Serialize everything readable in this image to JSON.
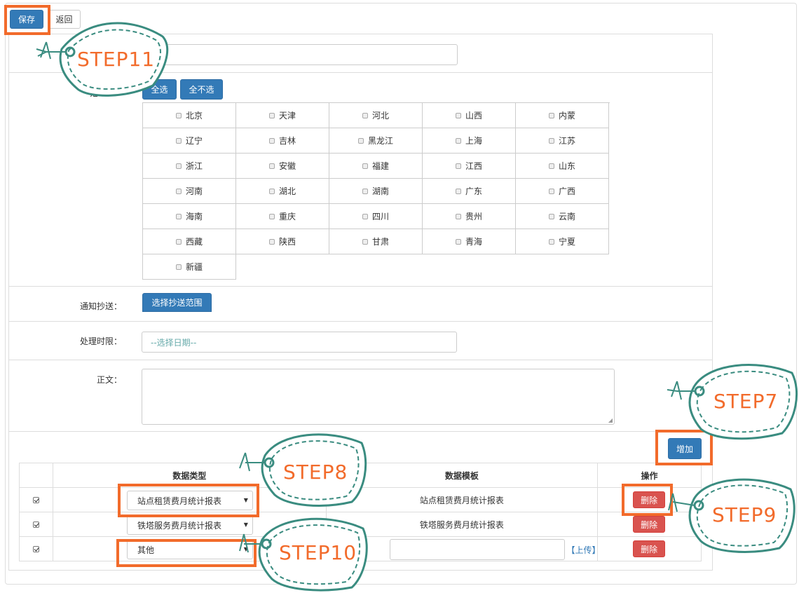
{
  "toolbar": {
    "save_label": "保存",
    "back_label": "返回"
  },
  "form": {
    "scope_label_partial": "范",
    "select_all_label": "全选",
    "select_none_label": "全不选",
    "provinces": [
      "北京",
      "天津",
      "河北",
      "山西",
      "内蒙",
      "辽宁",
      "吉林",
      "黑龙江",
      "上海",
      "江苏",
      "浙江",
      "安徽",
      "福建",
      "江西",
      "山东",
      "河南",
      "湖北",
      "湖南",
      "广东",
      "广西",
      "海南",
      "重庆",
      "四川",
      "贵州",
      "云南",
      "西藏",
      "陕西",
      "甘肃",
      "青海",
      "宁夏",
      "新疆"
    ],
    "cc_label": "通知抄送：",
    "cc_button": "选择抄送范围",
    "deadline_label": "处理时限：",
    "deadline_placeholder": "--选择日期--",
    "body_label": "正文："
  },
  "table": {
    "add_label": "增加",
    "headers": {
      "check": "",
      "type": "数据类型",
      "template": "数据模板",
      "action": "操作"
    },
    "rows": [
      {
        "checked": true,
        "type": "站点租赁费月统计报表",
        "template": "站点租赁费月统计报表",
        "delete": "删除"
      },
      {
        "checked": true,
        "type": "铁塔服务费月统计报表",
        "template": "铁塔服务费月统计报表",
        "delete": "删除"
      },
      {
        "checked": true,
        "type": "其他",
        "template": "",
        "upload": "【上传】",
        "delete": "删除"
      }
    ]
  },
  "annotations": {
    "step11": "STEP11",
    "step7": "STEP7",
    "step8": "STEP8",
    "step9": "STEP9",
    "step10": "STEP10",
    "highlight_color": "#f26b2b",
    "tag_color": "#3a8c80"
  }
}
